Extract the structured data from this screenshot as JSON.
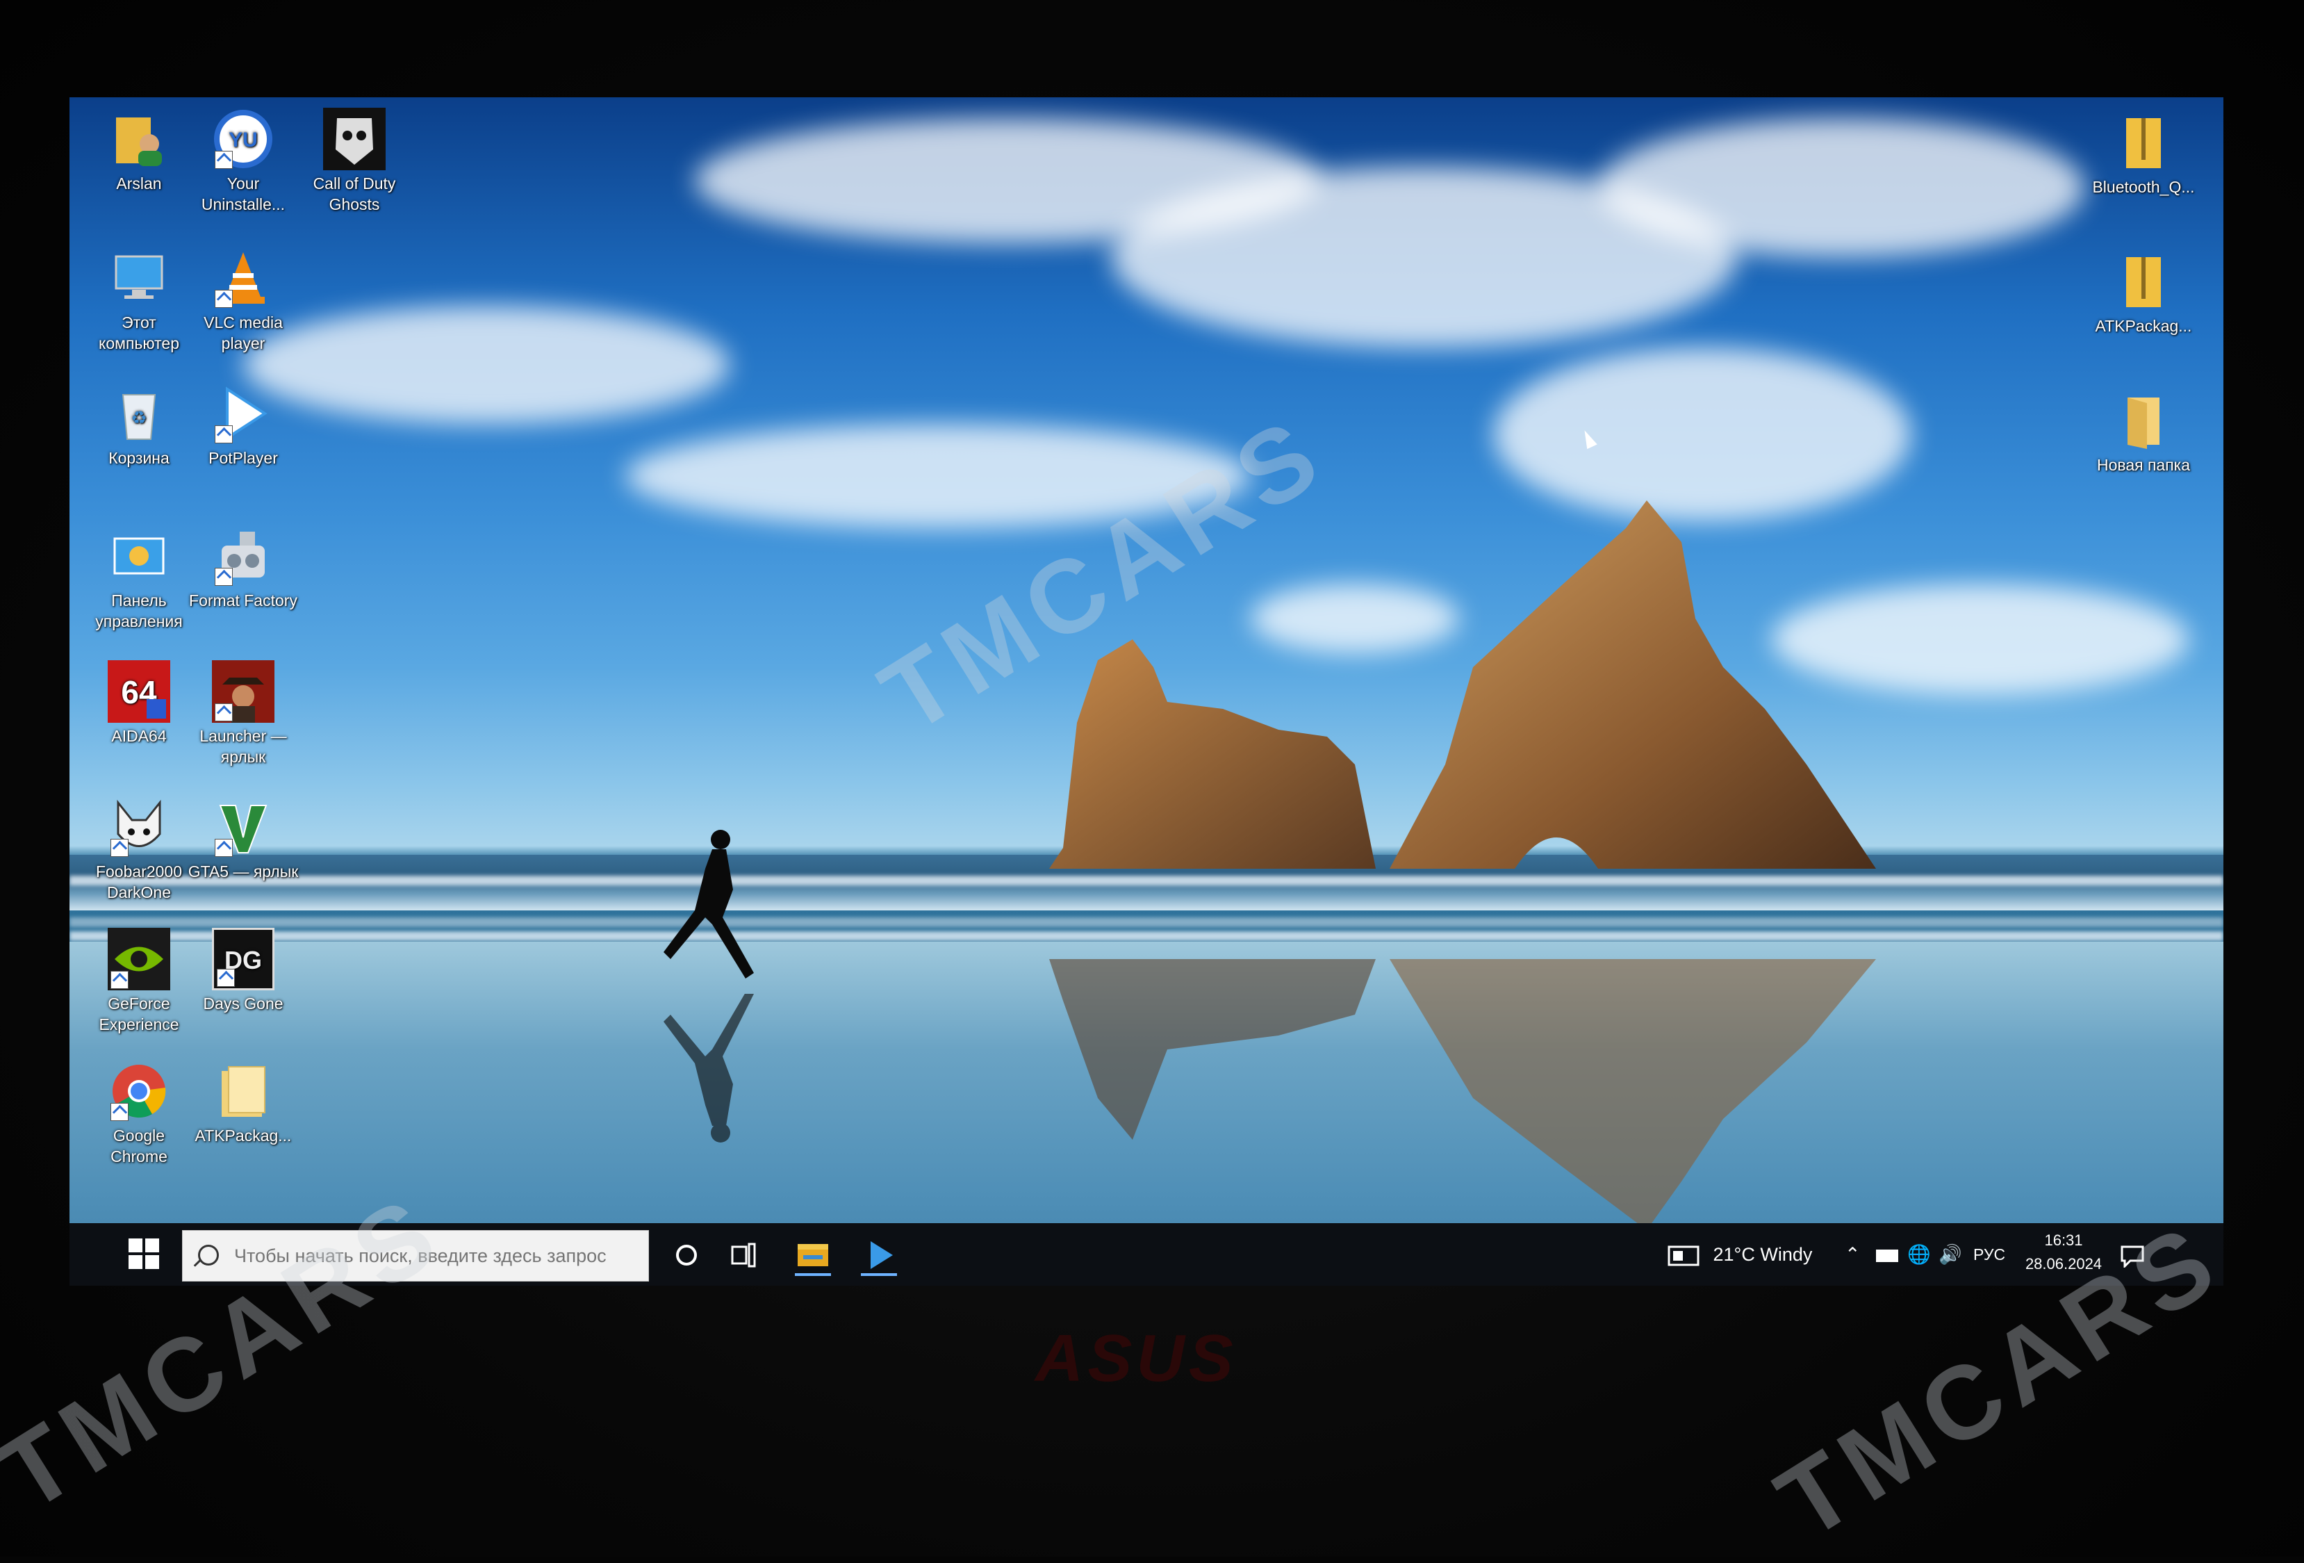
{
  "desktop": {
    "left_icons": [
      {
        "name": "arslan-user-folder-icon",
        "label": "Arslan"
      },
      {
        "name": "your-uninstaller-icon",
        "label": "Your Uninstalle..."
      },
      {
        "name": "call-of-duty-ghosts-icon",
        "label": "Call of Duty Ghosts"
      },
      {
        "name": "this-computer-icon",
        "label": "Этот компьютер"
      },
      {
        "name": "vlc-media-player-icon",
        "label": "VLC media player"
      },
      {
        "name": "recycle-bin-icon",
        "label": "Корзина"
      },
      {
        "name": "potplayer-icon",
        "label": "PotPlayer"
      },
      {
        "name": "control-panel-icon",
        "label": "Панель управления"
      },
      {
        "name": "format-factory-icon",
        "label": "Format Factory"
      },
      {
        "name": "aida64-icon",
        "label": "AIDA64"
      },
      {
        "name": "launcher-shortcut-icon",
        "label": "Launcher — ярлык"
      },
      {
        "name": "foobar2000-icon",
        "label": "Foobar2000 DarkOne"
      },
      {
        "name": "gta5-shortcut-icon",
        "label": "GTA5 — ярлык"
      },
      {
        "name": "geforce-experience-icon",
        "label": "GeForce Experience"
      },
      {
        "name": "days-gone-icon",
        "label": "Days Gone"
      },
      {
        "name": "google-chrome-icon",
        "label": "Google Chrome"
      },
      {
        "name": "atkpackage-folder-icon",
        "label": "ATKPackag..."
      }
    ],
    "right_icons": [
      {
        "name": "bluetooth-archive-icon",
        "label": "Bluetooth_Q..."
      },
      {
        "name": "atkpackage-archive-icon",
        "label": "ATKPackag..."
      },
      {
        "name": "new-folder-icon",
        "label": "Новая папка"
      }
    ]
  },
  "taskbar": {
    "search_placeholder": "Чтобы начать поиск, введите здесь запрос",
    "weather": "21°C  Windy",
    "language": "РУС",
    "time": "16:31",
    "date": "28.06.2024"
  },
  "monitor": {
    "brand": "ASUS"
  },
  "watermark": {
    "text": "TMCARS"
  },
  "colors": {
    "taskbar": "#0c0f14",
    "accent": "#6fb3ff"
  }
}
